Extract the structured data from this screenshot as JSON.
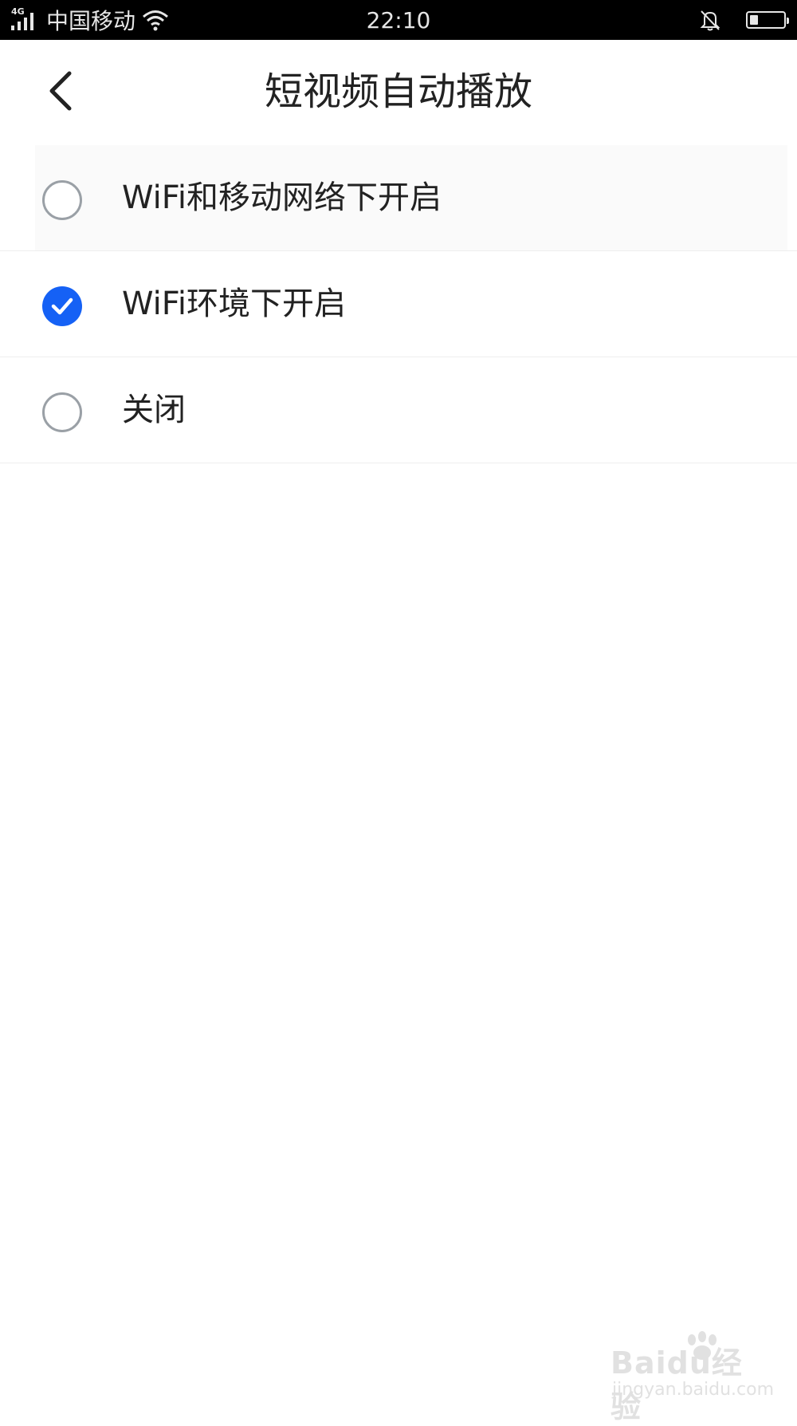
{
  "status_bar": {
    "network": "4G",
    "carrier": "中国移动",
    "time": "22:10",
    "battery_level": 0.25
  },
  "header": {
    "title": "短视频自动播放",
    "back_icon": "chevron-left-icon"
  },
  "options": [
    {
      "label": "WiFi和移动网络下开启",
      "selected": false
    },
    {
      "label": "WiFi环境下开启",
      "selected": true
    },
    {
      "label": "关闭",
      "selected": false
    }
  ],
  "colors": {
    "accent": "#1561f5",
    "text": "#222222",
    "radio_border": "#9aa0a6",
    "divider": "#eeeeee"
  },
  "watermark": {
    "main": "Baidu经验",
    "sub": "jingyan.baidu.com"
  }
}
